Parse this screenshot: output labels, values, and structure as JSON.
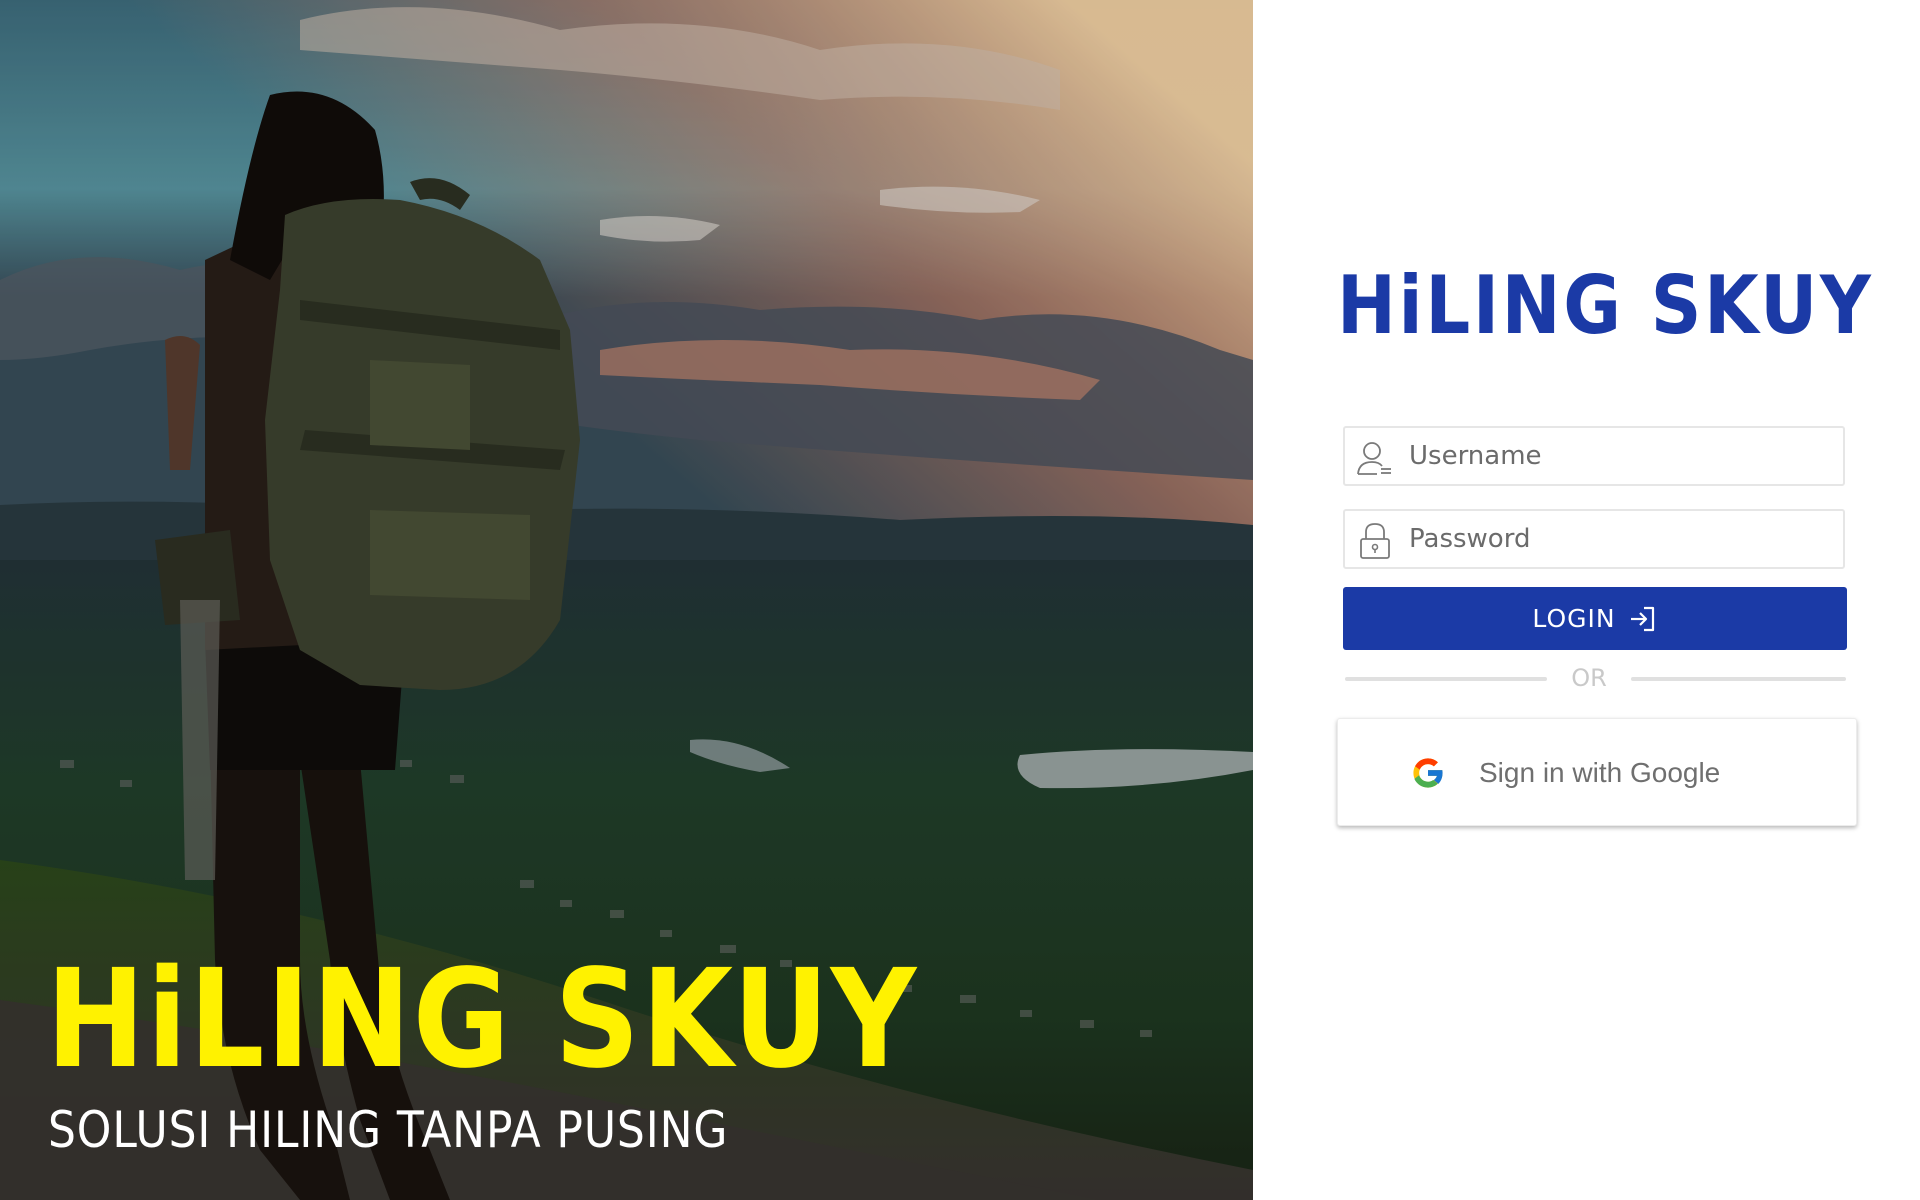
{
  "hero": {
    "title": "HiLING SKUY",
    "tagline": "SOLUSI HILING TANPA PUSING",
    "image_icon": "hiker-with-backpack-at-sunset-image"
  },
  "login": {
    "brand": "HiLING SKUY",
    "username": {
      "placeholder": "Username",
      "value": "",
      "icon": "user-icon"
    },
    "password": {
      "placeholder": "Password",
      "value": "",
      "icon": "lock-icon"
    },
    "login_button": {
      "label": "LOGIN",
      "icon": "sign-in-icon"
    },
    "divider_text": "OR",
    "google_button": {
      "label": "Sign in with Google",
      "icon": "google-icon"
    }
  },
  "colors": {
    "brand_blue": "#1b3aa6",
    "hero_title_yellow": "#fff200",
    "divider_gray": "#e0e0e0"
  }
}
